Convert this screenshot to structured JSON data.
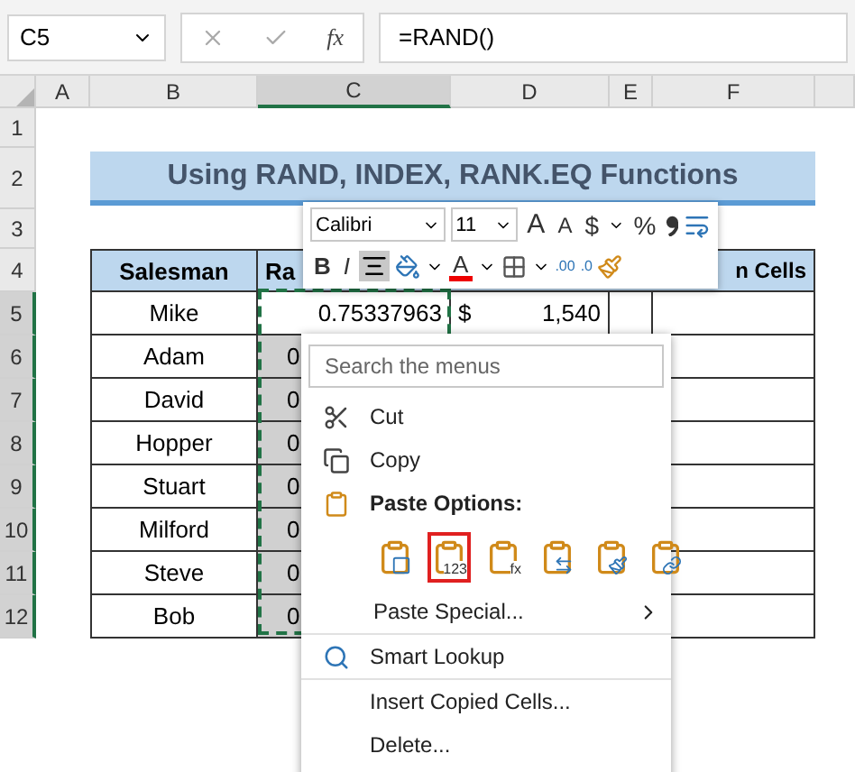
{
  "formula_bar": {
    "name_box": "C5",
    "fx": "fx",
    "formula": "=RAND()"
  },
  "columns": [
    {
      "label": "A",
      "selected": false
    },
    {
      "label": "B",
      "selected": false
    },
    {
      "label": "C",
      "selected": true
    },
    {
      "label": "D",
      "selected": false
    },
    {
      "label": "E",
      "selected": false
    },
    {
      "label": "F",
      "selected": false
    }
  ],
  "row_numbers": [
    {
      "label": "1",
      "selected": false
    },
    {
      "label": "2",
      "selected": false
    },
    {
      "label": "3",
      "selected": false
    },
    {
      "label": "4",
      "selected": false
    },
    {
      "label": "5",
      "selected": true
    },
    {
      "label": "6",
      "selected": true
    },
    {
      "label": "7",
      "selected": true
    },
    {
      "label": "8",
      "selected": true
    },
    {
      "label": "9",
      "selected": true
    },
    {
      "label": "10",
      "selected": true
    },
    {
      "label": "11",
      "selected": true
    },
    {
      "label": "12",
      "selected": true
    }
  ],
  "title": "Using RAND, INDEX, RANK.EQ Functions",
  "table": {
    "headers": [
      "Salesman",
      "Ra",
      "n Cells"
    ],
    "rows": [
      {
        "salesman": "Mike",
        "random": "0.75337963",
        "currency": "$",
        "amount": "1,540",
        "highlighted": false
      },
      {
        "salesman": "Adam",
        "random": "0",
        "highlighted": true
      },
      {
        "salesman": "David",
        "random": "0",
        "highlighted": true
      },
      {
        "salesman": "Hopper",
        "random": "0",
        "highlighted": true
      },
      {
        "salesman": "Stuart",
        "random": "0",
        "highlighted": true
      },
      {
        "salesman": "Milford",
        "random": "0",
        "highlighted": true
      },
      {
        "salesman": "Steve",
        "random": "0",
        "highlighted": true
      },
      {
        "salesman": "Bob",
        "random": "0",
        "highlighted": true
      }
    ]
  },
  "mini_toolbar": {
    "font": "Calibri",
    "size": "11",
    "grow_font": "A",
    "shrink_font": "A",
    "currency": "$",
    "percent": "%",
    "bold": "B",
    "italic": "I",
    "font_color": "A",
    "increase_decimal": ".00",
    "decrease_decimal": ".0",
    "center_selected": true
  },
  "context_menu": {
    "search_placeholder": "Search the menus",
    "items": [
      {
        "kind": "command",
        "label": "Cut"
      },
      {
        "kind": "command",
        "label": "Copy"
      },
      {
        "kind": "heading",
        "label": "Paste Options:"
      },
      {
        "kind": "paste",
        "options": [
          {
            "selected": false
          },
          {
            "selected": true,
            "label": "123"
          },
          {
            "selected": false,
            "label": "fx"
          },
          {
            "selected": false
          },
          {
            "selected": false
          },
          {
            "selected": false
          }
        ]
      },
      {
        "kind": "submenu",
        "label": "Paste Special..."
      },
      {
        "kind": "command",
        "label": "Smart Lookup",
        "divided": true
      },
      {
        "kind": "command",
        "label": "Insert Copied Cells...",
        "divided": true
      },
      {
        "kind": "command",
        "label": "Delete..."
      }
    ]
  }
}
